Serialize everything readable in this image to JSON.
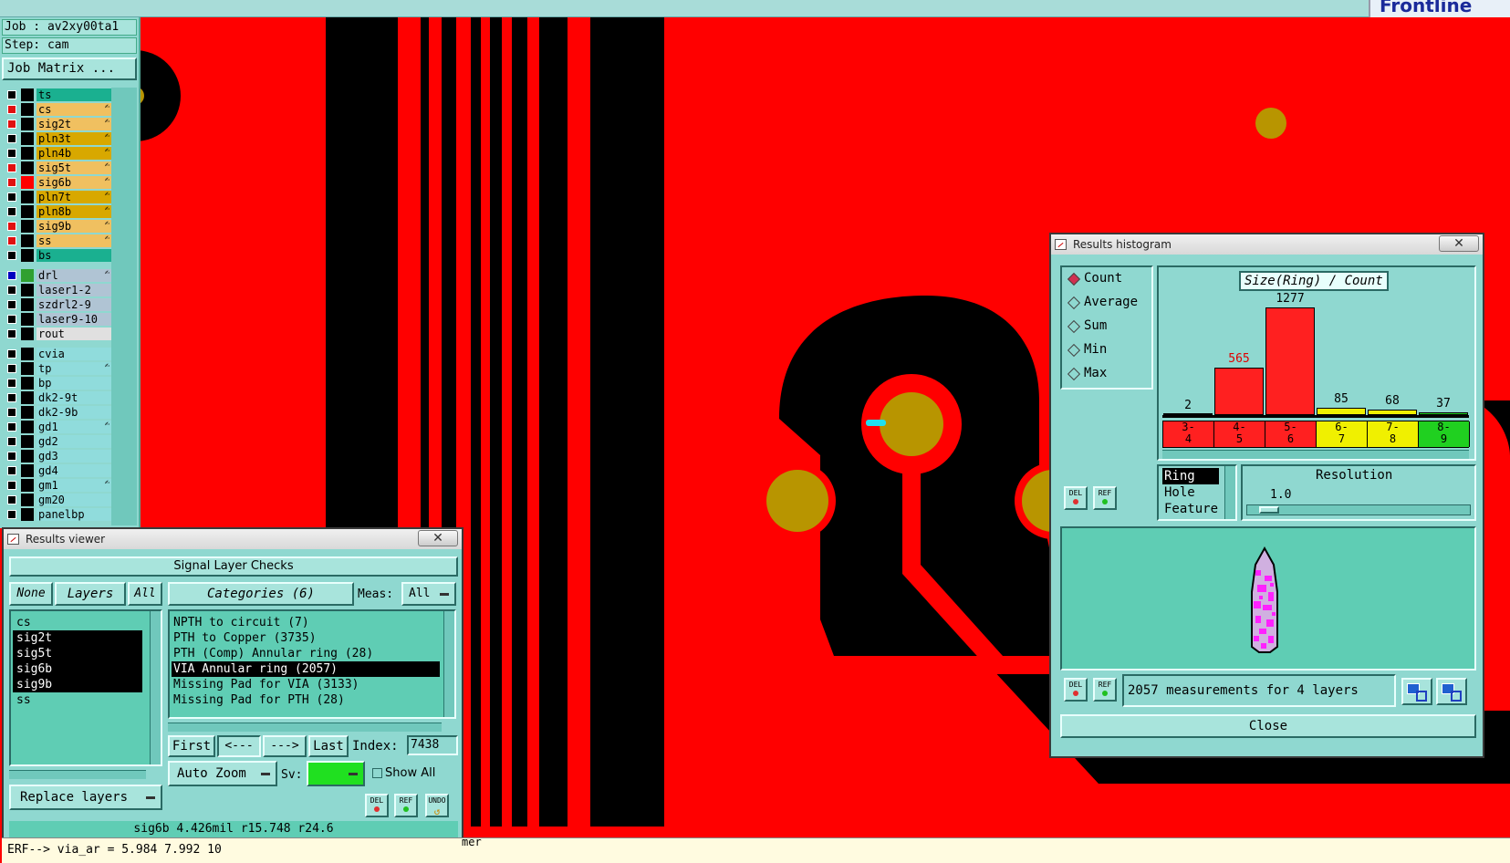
{
  "app": {
    "logo": "Frontline",
    "job_label": "Job : av2xy00ta1",
    "step_label": "Step: cam",
    "job_matrix_button": "Job Matrix ..."
  },
  "layers_panel": {
    "groups": [
      [
        {
          "name": "ts",
          "color": "teal",
          "checked": false,
          "swatch": "black",
          "edit": false
        },
        {
          "name": "cs",
          "color": "orange",
          "checked": true,
          "swatch": "black",
          "edit": true
        },
        {
          "name": "sig2t",
          "color": "orange",
          "checked": true,
          "swatch": "black",
          "edit": true
        },
        {
          "name": "pln3t",
          "color": "dark",
          "checked": false,
          "swatch": "black",
          "edit": true
        },
        {
          "name": "pln4b",
          "color": "dark",
          "checked": false,
          "swatch": "black",
          "edit": true
        },
        {
          "name": "sig5t",
          "color": "orange",
          "checked": true,
          "swatch": "black",
          "edit": true
        },
        {
          "name": "sig6b",
          "color": "orange",
          "checked": true,
          "swatch": "red",
          "edit": true
        },
        {
          "name": "pln7t",
          "color": "dark",
          "checked": false,
          "swatch": "black",
          "edit": true
        },
        {
          "name": "pln8b",
          "color": "dark",
          "checked": false,
          "swatch": "black",
          "edit": true
        },
        {
          "name": "sig9b",
          "color": "orange",
          "checked": true,
          "swatch": "black",
          "edit": true
        },
        {
          "name": "ss",
          "color": "orange",
          "checked": true,
          "swatch": "black",
          "edit": true
        },
        {
          "name": "bs",
          "color": "teal",
          "checked": false,
          "swatch": "black",
          "edit": false
        }
      ],
      [
        {
          "name": "drl",
          "color": "gray",
          "checked": true,
          "swatch": "green",
          "edit": true,
          "blue": true
        },
        {
          "name": "laser1-2",
          "color": "gray",
          "checked": false,
          "swatch": "black",
          "edit": false
        },
        {
          "name": "szdrl2-9",
          "color": "gray",
          "checked": false,
          "swatch": "black",
          "edit": false
        },
        {
          "name": "laser9-10",
          "color": "gray",
          "checked": false,
          "swatch": "black",
          "edit": false
        },
        {
          "name": "rout",
          "color": "lgray",
          "checked": false,
          "swatch": "black",
          "edit": false
        }
      ],
      [
        {
          "name": "cvia",
          "color": "cyan",
          "checked": false,
          "swatch": "black",
          "edit": false
        },
        {
          "name": "tp",
          "color": "cyan",
          "checked": false,
          "swatch": "black",
          "edit": true
        },
        {
          "name": "bp",
          "color": "cyan",
          "checked": false,
          "swatch": "black",
          "edit": false
        },
        {
          "name": "dk2-9t",
          "color": "cyan",
          "checked": false,
          "swatch": "black",
          "edit": false
        },
        {
          "name": "dk2-9b",
          "color": "cyan",
          "checked": false,
          "swatch": "black",
          "edit": false
        },
        {
          "name": "gd1",
          "color": "cyan",
          "checked": false,
          "swatch": "black",
          "edit": true
        },
        {
          "name": "gd2",
          "color": "cyan",
          "checked": false,
          "swatch": "black",
          "edit": false
        },
        {
          "name": "gd3",
          "color": "cyan",
          "checked": false,
          "swatch": "black",
          "edit": false
        },
        {
          "name": "gd4",
          "color": "cyan",
          "checked": false,
          "swatch": "black",
          "edit": false
        },
        {
          "name": "gm1",
          "color": "cyan",
          "checked": false,
          "swatch": "black",
          "edit": true
        },
        {
          "name": "gm20",
          "color": "cyan",
          "checked": false,
          "swatch": "black",
          "edit": false
        },
        {
          "name": "panelbp",
          "color": "cyan",
          "checked": false,
          "swatch": "black",
          "edit": false
        }
      ]
    ],
    "edit_icon": "hand-icon"
  },
  "results_viewer": {
    "title": "Results viewer",
    "close": "✕",
    "header": "Signal Layer Checks",
    "none_btn": "None",
    "layers_btn": "Layers",
    "all_btn": "All",
    "categories_btn": "Categories (6)",
    "meas_label": "Meas:",
    "meas_value": "All",
    "layers": [
      {
        "name": "cs",
        "selected": false
      },
      {
        "name": "sig2t",
        "selected": true
      },
      {
        "name": "sig5t",
        "selected": true
      },
      {
        "name": "sig6b",
        "selected": true
      },
      {
        "name": "sig9b",
        "selected": true
      },
      {
        "name": "ss",
        "selected": false
      }
    ],
    "categories": [
      {
        "name": "NPTH to circuit (7)",
        "selected": false
      },
      {
        "name": "PTH to Copper (3735)",
        "selected": false
      },
      {
        "name": "PTH (Comp) Annular ring (28)",
        "selected": false
      },
      {
        "name": "VIA Annular ring (2057)",
        "selected": true
      },
      {
        "name": "Missing Pad for VIA (3133)",
        "selected": false
      },
      {
        "name": "Missing Pad for PTH (28)",
        "selected": false
      }
    ],
    "first_btn": "First",
    "prev_btn": "<---",
    "next_btn": "--->",
    "last_btn": "Last",
    "index_label": "Index:",
    "index_value": "7438",
    "auto_zoom": "Auto Zoom",
    "sv_label": "Sv:",
    "show_all": "Show All",
    "replace_layers": "Replace layers",
    "del_btn": "DEL",
    "ref_btn": "REF",
    "undo_btn": "UNDO",
    "status": "sig6b 4.426mil  r15.748  r24.6",
    "command": "ERF--> via_ar = 5.984 7.992 10",
    "partial_text": "mer"
  },
  "histogram": {
    "title": "Results histogram",
    "close": "✕",
    "modes": [
      {
        "label": "Count",
        "on": true
      },
      {
        "label": "Average",
        "on": false
      },
      {
        "label": "Sum",
        "on": false
      },
      {
        "label": "Min",
        "on": false
      },
      {
        "label": "Max",
        "on": false
      }
    ],
    "chart_title": "Size(Ring) / Count",
    "bins": [
      {
        "label": "3-\n4",
        "count": 2,
        "color": "#ff2020",
        "labelcolor": "#000"
      },
      {
        "label": "4-\n5",
        "count": 565,
        "color": "#ff2020",
        "labelcolor": "#e00000"
      },
      {
        "label": "5-\n6",
        "count": 1277,
        "color": "#ff2020",
        "labelcolor": "#000"
      },
      {
        "label": "6-\n7",
        "count": 85,
        "color": "#f0f000",
        "labelcolor": "#000"
      },
      {
        "label": "7-\n8",
        "count": 68,
        "color": "#f0f000",
        "labelcolor": "#000"
      },
      {
        "label": "8-\n9",
        "count": 37,
        "color": "#20d020",
        "labelcolor": "#000"
      }
    ],
    "max_count": 1277,
    "size_types": [
      {
        "label": "Ring",
        "selected": true
      },
      {
        "label": "Hole",
        "selected": false
      },
      {
        "label": "Feature",
        "selected": false
      }
    ],
    "resolution_label": "Resolution",
    "resolution_value": "1.0",
    "resolution_level": 0.06,
    "del_btn": "DEL",
    "ref_btn": "REF",
    "summary": "2057 measurements for 4 layers",
    "close_btn": "Close"
  }
}
